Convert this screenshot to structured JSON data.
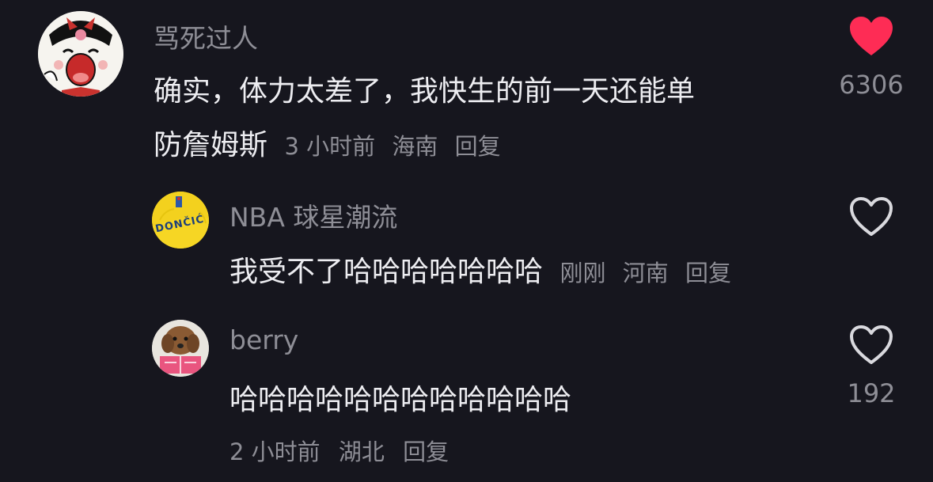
{
  "comments": [
    {
      "username": "骂死过人",
      "text_line1": "确实，体力太差了，我快生的前一天还能单",
      "text_line2": "防詹姆斯",
      "time": "3 小时前",
      "location": "海南",
      "reply": "回复",
      "likes": "6306",
      "liked": true,
      "avatar_icon": "cartoon-cat-avatar-icon"
    },
    {
      "username": "NBA 球星潮流",
      "text": "我受不了哈哈哈哈哈哈哈",
      "time": "刚刚",
      "location": "河南",
      "reply": "回复",
      "likes": "",
      "liked": false,
      "avatar_icon": "doncic-jersey-avatar-icon",
      "avatar_text": "DONČIĆ"
    },
    {
      "username": "berry",
      "text": "哈哈哈哈哈哈哈哈哈哈哈哈",
      "time": "2 小时前",
      "location": "湖北",
      "reply": "回复",
      "likes": "192",
      "liked": false,
      "avatar_icon": "dog-reading-book-avatar-icon"
    }
  ],
  "colors": {
    "background": "#16161e",
    "liked_heart": "#fe2c55",
    "secondary_text": "#8e8e96",
    "primary_text": "#ededf1"
  }
}
